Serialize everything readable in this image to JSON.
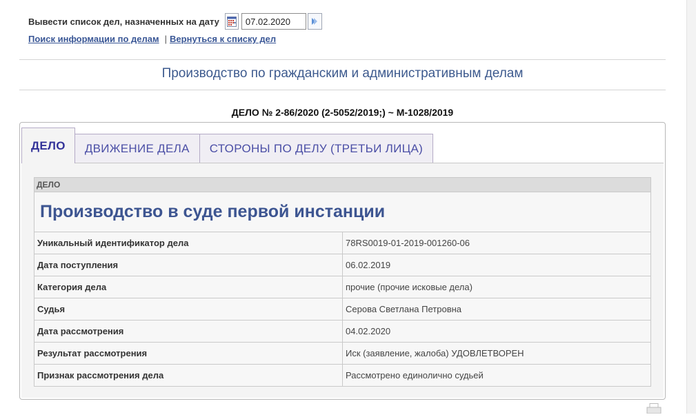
{
  "filter": {
    "label": "Вывести список дел, назначенных на дату",
    "date_value": "07.02.2020",
    "icons": {
      "calendar": "calendar-icon",
      "go": "arrow-go-icon"
    }
  },
  "links": {
    "search": "Поиск информации по делам",
    "separator": "|",
    "back": "Вернуться к списку дел"
  },
  "section_title": "Производство по гражданским и административным делам",
  "case_number": "ДЕЛО № 2-86/2020 (2-5052/2019;) ~ М-1028/2019",
  "tabs": [
    {
      "label": "ДЕЛО",
      "active": true
    },
    {
      "label": "ДВИЖЕНИЕ ДЕЛА",
      "active": false
    },
    {
      "label": "СТОРОНЫ ПО ДЕЛУ (ТРЕТЬИ ЛИЦА)",
      "active": false
    }
  ],
  "case_table": {
    "header": "ДЕЛО",
    "heading": "Производство в суде первой инстанции",
    "rows": [
      {
        "label": "Уникальный идентификатор дела",
        "value": "78RS0019-01-2019-001260-06"
      },
      {
        "label": "Дата поступления",
        "value": "06.02.2019"
      },
      {
        "label": "Категория дела",
        "value": "прочие (прочие исковые дела)"
      },
      {
        "label": "Судья",
        "value": "Серова Светлана Петровна"
      },
      {
        "label": "Дата рассмотрения",
        "value": "04.02.2020"
      },
      {
        "label": "Результат рассмотрения",
        "value": "Иск (заявление, жалоба) УДОВЛЕТВОРЕН"
      },
      {
        "label": "Признак рассмотрения дела",
        "value": "Рассмотрено единолично судьей"
      }
    ]
  },
  "colors": {
    "accent": "#3d5a8e",
    "link": "#3a5796",
    "tab_text": "#4b4fa6"
  }
}
